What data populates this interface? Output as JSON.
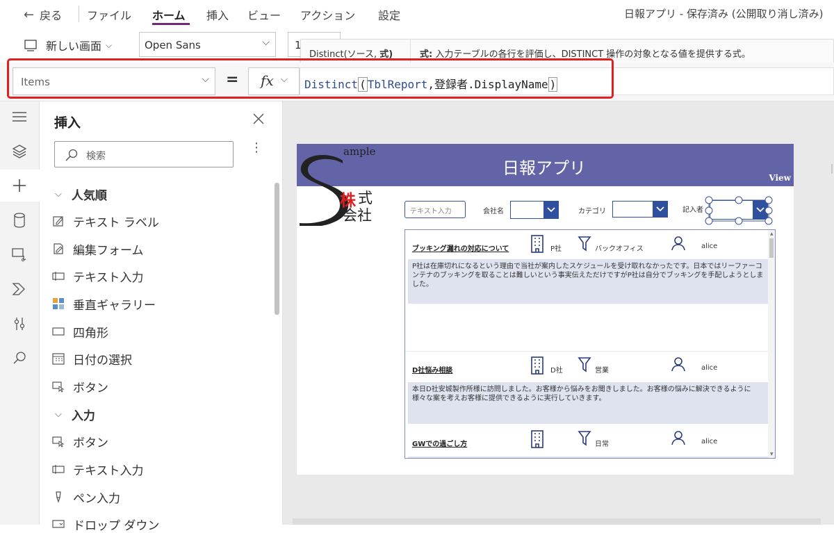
{
  "menu": {
    "back": "戻る",
    "file": "ファイル",
    "home": "ホーム",
    "insert": "挿入",
    "view": "ビュー",
    "action": "アクション",
    "settings": "設定",
    "app_status": "日報アプリ - 保存済み (公開取り消し済み)"
  },
  "ribbon": {
    "new_screen": "新しい画面",
    "font": "Open Sans",
    "font_size": "1",
    "tooltip_signature_prefix": "Distinct(ソース, ",
    "tooltip_signature_bold": "式)",
    "tooltip_label": "式:",
    "tooltip_text": "入力テーブルの各行を評価し、DISTINCT 操作の対象となる値を提供する式。"
  },
  "formula": {
    "property": "Items",
    "equals": "=",
    "fx": "fx",
    "fn": "Distinct",
    "open_paren": "(",
    "source": "TblReport",
    "rest": ",登録者.DisplayName",
    "close_paren": ")"
  },
  "panel": {
    "title": "挿入",
    "search_placeholder": "検索",
    "section_popular": "人気順",
    "popular": [
      "テキスト ラベル",
      "編集フォーム",
      "テキスト入力",
      "垂直ギャラリー",
      "四角形",
      "日付の選択",
      "ボタン"
    ],
    "section_input": "入力",
    "input": [
      "ボタン",
      "テキスト入力",
      "ペン入力",
      "ドロップ ダウン"
    ]
  },
  "app": {
    "header_title": "日報アプリ",
    "view_label": "View",
    "logo_top": "ample",
    "logo_red": "株",
    "logo_rest1": "式",
    "logo_rest2": "会社",
    "text_input_placeholder": "テキスト入力",
    "company_label": "会社名",
    "category_label": "カテゴリ",
    "author_label": "記入者",
    "rows": [
      {
        "title": "ブッキング漏れの対応について",
        "company": "P社",
        "category": "バックオフィス",
        "user": "alice",
        "body": "P社は在庫切れになるという理由で当社が案内したスケジュールを受け取れなかったです。日本ではリーファーコンテナのブッキングを取ることは難しいという事実伝えただけですがP社は自分でブッキングを手配しようとしました。"
      },
      {
        "title": "D社悩み相談",
        "company": "D社",
        "category": "営業",
        "user": "alice",
        "body": "本日D社安城製作所様に訪問しました。お客様から悩みをお聞きしました。お客様の悩みに解決できるように様々な案を考えお客様に提供できるように実行していきます。"
      },
      {
        "title": "GWでの過ごし方",
        "company": "",
        "category": "日常",
        "user": "alice",
        "body": ""
      }
    ]
  },
  "colors": {
    "accent_purple": "#742774",
    "header_bar": "#6264a7",
    "dropdown_blue": "#2f4f9f",
    "highlight_red": "#e02020"
  }
}
